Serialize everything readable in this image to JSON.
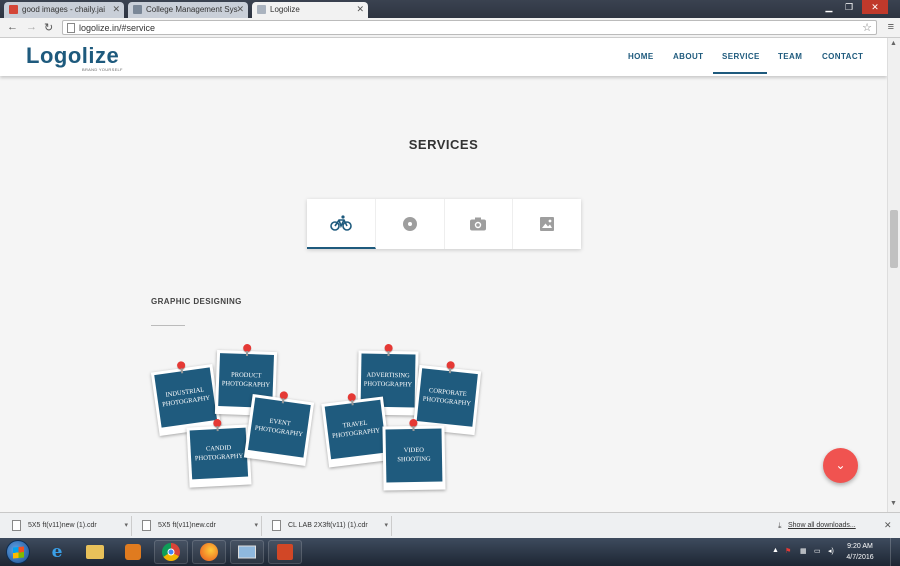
{
  "browser": {
    "tabs": [
      {
        "title": "good images - chaily.jai",
        "active": false,
        "icon": "gmail-icon",
        "color": "#d44638"
      },
      {
        "title": "College Management Sys",
        "active": false,
        "icon": "page-icon",
        "color": "#7a8797"
      },
      {
        "title": "Logolize",
        "active": true,
        "icon": "page-icon",
        "color": "#aab3bf"
      }
    ],
    "url": "logolize.in/#service"
  },
  "site": {
    "logo": "Logolize",
    "tagline": "BRAND YOURSELF",
    "nav": [
      "HOME",
      "ABOUT",
      "SERVICE",
      "TEAM",
      "CONTACT"
    ],
    "active_nav": "SERVICE",
    "section_title": "SERVICES",
    "service_tabs": [
      {
        "icon": "bicycle-icon",
        "active": true
      },
      {
        "icon": "disc-icon",
        "active": false
      },
      {
        "icon": "camera-icon",
        "active": false
      },
      {
        "icon": "image-icon",
        "active": false
      }
    ],
    "sub_heading": "GRAPHIC DESIGNING",
    "photos": [
      {
        "label": "INDUSTRIAL PHOTOGRAPHY"
      },
      {
        "label": "PRODUCT PHOTOGRAPHY"
      },
      {
        "label": "EVENT PHOTOGRAPHY"
      },
      {
        "label": "CANDID PHOTOGRAPHY"
      },
      {
        "label": "ADVERTISING PHOTOGRAPHY"
      },
      {
        "label": "CORPORATE PHOTOGRAPHY"
      },
      {
        "label": "TRAVEL PHOTOGRAPHY"
      },
      {
        "label": "VIDEO SHOOTING"
      }
    ]
  },
  "downloads": {
    "items": [
      "5X5 ft(v11)new (1).cdr",
      "5X5 ft(v11)new.cdr",
      "CL LAB 2X3ft(v11) (1).cdr"
    ],
    "show_all": "Show all downloads..."
  },
  "taskbar": {
    "time": "9:20 AM",
    "date": "4/7/2016",
    "apps": [
      "internet-explorer-icon",
      "file-explorer-icon",
      "media-player-icon",
      "chrome-icon",
      "firefox-icon",
      "remote-desktop-icon",
      "powerpoint-icon"
    ]
  },
  "colors": {
    "brand": "#1e5a7d",
    "fab": "#f05350",
    "photo": "#1f5b7e"
  }
}
